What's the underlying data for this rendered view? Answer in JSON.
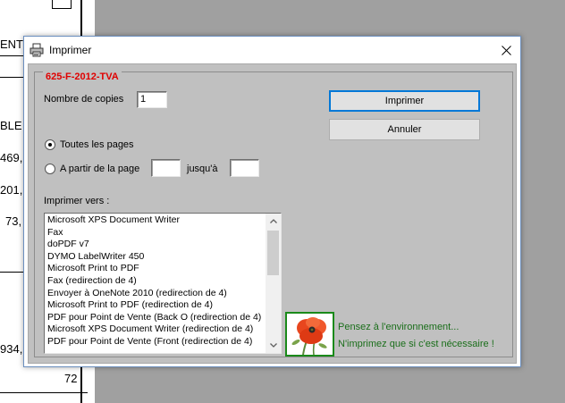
{
  "background_doc": {
    "texts": [
      "ENT",
      "BLE",
      "469,",
      "201,",
      "73,",
      "934,",
      "72"
    ]
  },
  "dialog": {
    "title": "Imprimer",
    "icons": {
      "title": "printer-icon",
      "close": "close-icon"
    },
    "group_title": "625-F-2012-TVA",
    "copies_label": "Nombre de copies",
    "copies_value": "1",
    "buttons": {
      "print": "Imprimer",
      "cancel": "Annuler"
    },
    "range": {
      "all_label": "Toutes les pages",
      "from_label": "A partir de la page",
      "to_label": "jusqu'à",
      "from_value": "",
      "to_value": "",
      "selected": "all"
    },
    "printers_label": "Imprimer vers :",
    "printers": [
      "Microsoft XPS Document Writer",
      "Fax",
      "doPDF v7",
      "DYMO LabelWriter 450",
      "Microsoft Print to PDF",
      "Fax (redirection de 4)",
      "Envoyer à OneNote 2010 (redirection de 4)",
      "Microsoft Print to PDF (redirection de 4)",
      "PDF pour Point de Vente (Back O (redirection de 4)",
      "Microsoft XPS Document Writer (redirection de 4)",
      "PDF pour Point de Vente (Front (redirection de 4)"
    ],
    "eco_image": "poppy-flower-icon",
    "eco_line1": "Pensez à l'environnement...",
    "eco_line2": "N'imprimez que si c'est nécessaire !",
    "colors": {
      "group_title": "#e00000",
      "eco_text": "#1a6e1a",
      "default_button_border": "#0078d7"
    }
  }
}
